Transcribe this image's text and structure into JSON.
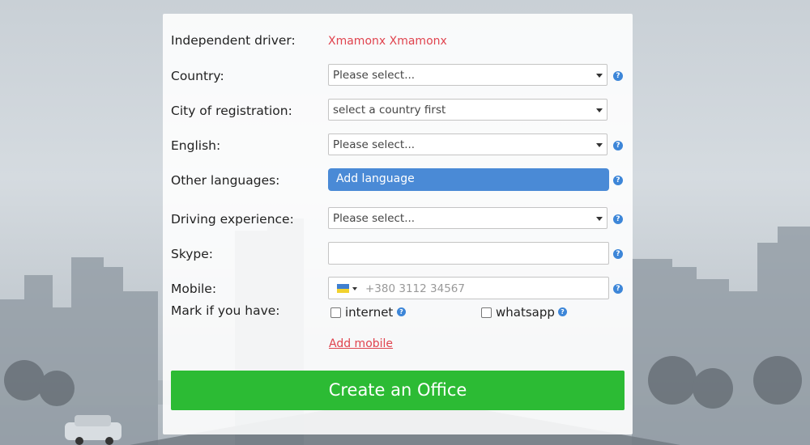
{
  "form": {
    "independent_driver_label": "Independent driver:",
    "independent_driver_value": "Xmamonx Xmamonx",
    "country_label": "Country:",
    "country_value": "Please select...",
    "city_label": "City of registration:",
    "city_value": "select a country first",
    "english_label": "English:",
    "english_value": "Please select...",
    "other_languages_label": "Other languages:",
    "add_language_label": "Add language",
    "driving_experience_label": "Driving experience:",
    "driving_experience_value": "Please select...",
    "skype_label": "Skype:",
    "skype_value": "",
    "mobile_label": "Mobile:",
    "mobile_placeholder": "+380 3112 34567",
    "mark_label": "Mark if you have:",
    "internet_label": "internet",
    "whatsapp_label": "whatsapp",
    "add_mobile_label": "Add mobile",
    "create_button_label": "Create an Office",
    "help_glyph": "?"
  },
  "colors": {
    "accent_red": "#e0434e",
    "button_blue": "#4a8ad6",
    "create_green": "#2cbb34",
    "help_blue": "#3d86d8"
  },
  "icons": {
    "help": "question-circle-icon",
    "flag": "ukraine-flag-icon",
    "caret": "chevron-down-icon"
  }
}
